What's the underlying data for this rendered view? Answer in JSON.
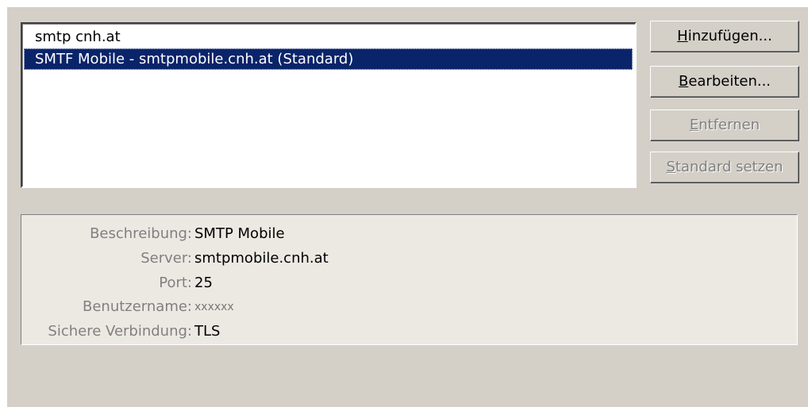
{
  "servers": {
    "items": [
      {
        "label": "smtp cnh.at",
        "selected": false
      },
      {
        "label": "SMTF Mobile - smtpmobile.cnh.at (Standard)",
        "selected": true
      }
    ]
  },
  "buttons": {
    "add": {
      "mnemonic": "H",
      "rest": "inzufügen...",
      "enabled": true
    },
    "edit": {
      "mnemonic": "B",
      "rest": "earbeiten...",
      "enabled": true
    },
    "remove": {
      "mnemonic": "E",
      "rest": "ntfernen",
      "enabled": false
    },
    "set_default": {
      "mnemonic": "S",
      "rest": "tandard setzen",
      "enabled": false
    }
  },
  "details": {
    "description": {
      "label": "Beschreibung:",
      "value": "SMTP Mobile"
    },
    "server": {
      "label": "Server:",
      "value": "smtpmobile.cnh.at"
    },
    "port": {
      "label": "Port:",
      "value": "25"
    },
    "username": {
      "label": "Benutzername:",
      "value": "xxxxxx"
    },
    "secure_connection": {
      "label": "Sichere Verbindung:",
      "value": "TLS"
    }
  },
  "colors": {
    "dialog_bg": "#d4d0c8",
    "selection_bg": "#0a246a",
    "disabled_text": "#808080"
  }
}
